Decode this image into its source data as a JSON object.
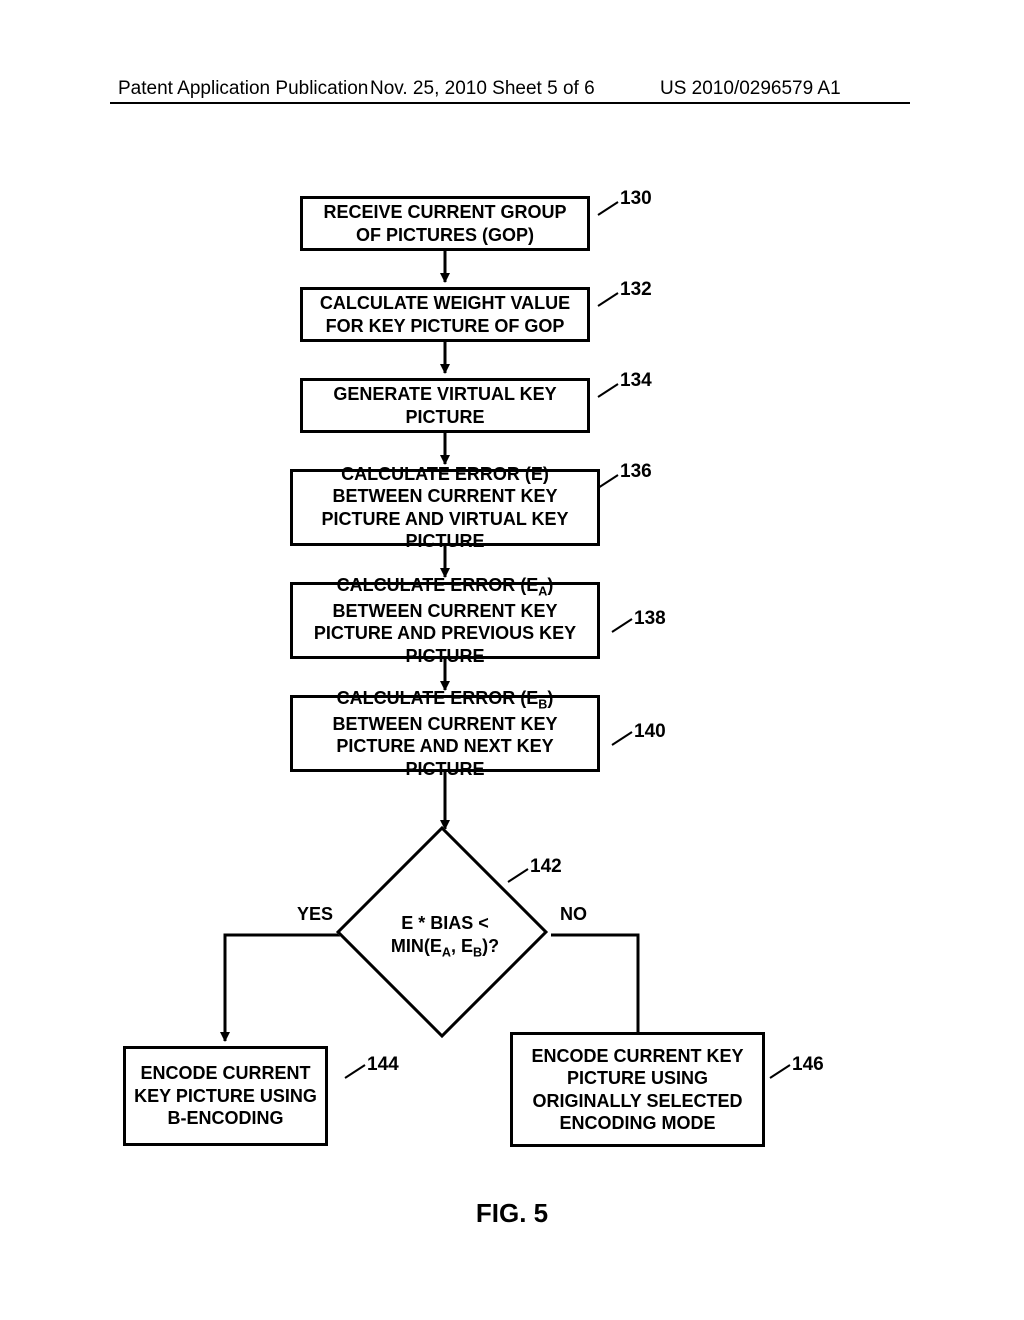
{
  "header": {
    "left": "Patent Application Publication",
    "middle": "Nov. 25, 2010  Sheet 5 of 6",
    "right": "US 2010/0296579 A1"
  },
  "fig_label": "FIG. 5",
  "boxes": {
    "b130": "RECEIVE CURRENT GROUP OF PICTURES (GOP)",
    "b132": "CALCULATE WEIGHT VALUE FOR KEY PICTURE OF GOP",
    "b134": "GENERATE VIRTUAL KEY PICTURE",
    "b136": "CALCULATE ERROR (E) BETWEEN CURRENT KEY PICTURE AND VIRTUAL KEY PICTURE",
    "b138_pre": "CALCULATE ERROR (E",
    "b138_sub": "A",
    "b138_post": ") BETWEEN CURRENT KEY PICTURE AND PREVIOUS KEY PICTURE",
    "b140_pre": "CALCULATE ERROR (E",
    "b140_sub": "B",
    "b140_post": ") BETWEEN CURRENT KEY PICTURE AND NEXT KEY PICTURE",
    "b144": "ENCODE CURRENT KEY PICTURE USING B-ENCODING",
    "b146": "ENCODE CURRENT KEY PICTURE USING ORIGINALLY SELECTED ENCODING MODE"
  },
  "decision": {
    "line1": "E * BIAS <",
    "line2_pre": "MIN(E",
    "line2_subA": "A",
    "line2_mid": ", E",
    "line2_subB": "B",
    "line2_post": ")?"
  },
  "refs": {
    "r130": "130",
    "r132": "132",
    "r134": "134",
    "r136": "136",
    "r138": "138",
    "r140": "140",
    "r142": "142",
    "r144": "144",
    "r146": "146"
  },
  "labels": {
    "yes": "YES",
    "no": "NO"
  }
}
